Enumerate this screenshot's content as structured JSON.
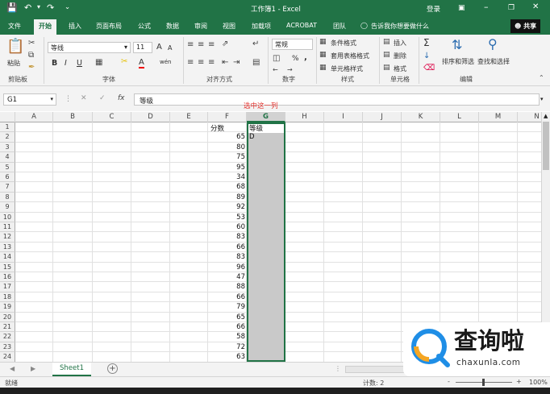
{
  "window": {
    "title": "工作簿1 - Excel",
    "login": "登录",
    "qat_more": "⌄"
  },
  "tabs": [
    "文件",
    "开始",
    "插入",
    "页面布局",
    "公式",
    "数据",
    "审阅",
    "视图",
    "加载项",
    "ACROBAT",
    "团队"
  ],
  "active_tab": "开始",
  "tell_me": "告诉我你想要做什么",
  "share": "共享",
  "ribbon": {
    "clipboard": {
      "paste": "粘贴",
      "group": "剪贴板"
    },
    "font": {
      "name": "等线",
      "size": "11",
      "bold": "B",
      "italic": "I",
      "underline": "U",
      "grow": "A",
      "shrink": "A",
      "wen": "wén",
      "group": "字体"
    },
    "alignment": {
      "group": "对齐方式"
    },
    "number": {
      "format": "常规",
      "percent": "%",
      "comma": ",",
      "group": "数字"
    },
    "styles": {
      "conditional": "条件格式",
      "table": "套用表格格式",
      "cell": "单元格样式",
      "group": "样式"
    },
    "cells": {
      "insert": "插入",
      "delete": "删除",
      "format": "格式",
      "group": "单元格"
    },
    "editing": {
      "sigma": "Σ",
      "sort": "排序和筛选",
      "find": "查找和选择",
      "group": "编辑"
    }
  },
  "formula_bar": {
    "name_box": "G1",
    "fx": "fx",
    "content": "等级"
  },
  "annotation": "选中这一列",
  "columns": [
    "A",
    "B",
    "C",
    "D",
    "E",
    "F",
    "G",
    "H",
    "I",
    "J",
    "K",
    "L",
    "M",
    "N"
  ],
  "selected_column": "G",
  "rows": [
    "1",
    "2",
    "3",
    "4",
    "5",
    "6",
    "7",
    "8",
    "9",
    "10",
    "11",
    "12",
    "13",
    "14",
    "15",
    "16",
    "17",
    "18",
    "19",
    "20",
    "21",
    "22",
    "23",
    "24"
  ],
  "cells": {
    "F1": "分数",
    "G1": "等级",
    "G2": "D",
    "F_values": [
      "65",
      "80",
      "75",
      "95",
      "34",
      "68",
      "89",
      "92",
      "53",
      "60",
      "83",
      "66",
      "83",
      "96",
      "47",
      "88",
      "66",
      "79",
      "65",
      "66",
      "58",
      "72",
      "63"
    ]
  },
  "sheet": {
    "name": "Sheet1",
    "add": "+"
  },
  "status": {
    "ready": "就绪",
    "count": "计数: 2",
    "zoom": "100%",
    "minus": "-",
    "plus": "+"
  },
  "watermark": {
    "brand": "查询啦",
    "url": "chaxunla.com"
  },
  "colors": {
    "excel_green": "#217346",
    "selection_gray": "#c9c9c9",
    "annotation_red": "#e5322d"
  }
}
